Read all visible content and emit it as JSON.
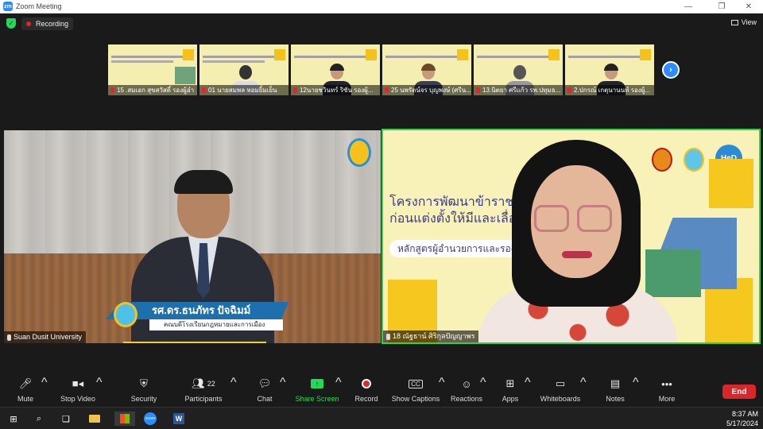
{
  "window": {
    "logo": "zm",
    "title": "Zoom Meeting",
    "controls": [
      "minimize-icon",
      "restore-icon",
      "close-icon"
    ]
  },
  "topbar": {
    "recording_label": "Recording",
    "view_label": "View"
  },
  "thumbnails": [
    {
      "name": "15 .สมเอก สุขสวัสดิ์ รองผู้อำ"
    },
    {
      "name": "01 นายสมพล หอมยิ้มเย็น"
    },
    {
      "name": "12นายชวินทร์ ริซัน รองผู้..."
    },
    {
      "name": "25 นพรัตน์จร บุญพงษ์ (ศรีน..."
    },
    {
      "name": "13.นิตยา ศรีแก้ว รพ.ปทุมธ..."
    },
    {
      "name": "2.ปกรณ์ เกตุนานนท์ รองผู้..."
    }
  ],
  "left_tile": {
    "lower_third_name": "รศ.ดร.ธนภัทร ปัจฉิมม์",
    "lower_third_title": "คณบดีโรงเรียนกฎหมายและการเมือง",
    "participant_name": "Suan Dusit University"
  },
  "right_tile": {
    "slide_title_line1": "โครงการพัฒนาข้าราชการ         ารศึกษา",
    "slide_title_line2": "ก่อนแต่งตั้งให้มีและเลื่อน",
    "slide_subtitle": "หลักสูตรผู้อำนวยการและรอง                        ะที่ 142",
    "hed_logo": "HeD",
    "participant_name": "18 ณัฐธาน์ ศิริกุลปัญญาพร"
  },
  "toolbar": {
    "items": [
      {
        "label": "Mute",
        "icon": "microphone-icon"
      },
      {
        "label": "Stop Video",
        "icon": "video-camera-icon"
      },
      {
        "label": "Security",
        "icon": "shield-icon"
      },
      {
        "label": "Participants",
        "icon": "participants-icon",
        "badge": "22"
      },
      {
        "label": "Chat",
        "icon": "chat-icon"
      },
      {
        "label": "Share Screen",
        "icon": "share-screen-icon"
      },
      {
        "label": "Record",
        "icon": "record-icon"
      },
      {
        "label": "Show Captions",
        "icon": "captions-icon",
        "glyph": "CC"
      },
      {
        "label": "Reactions",
        "icon": "reactions-icon"
      },
      {
        "label": "Apps",
        "icon": "apps-icon"
      },
      {
        "label": "Whiteboards",
        "icon": "whiteboard-icon"
      },
      {
        "label": "Notes",
        "icon": "notes-icon"
      },
      {
        "label": "More",
        "icon": "more-icon"
      }
    ],
    "end_label": "End",
    "share_color": "#23d959",
    "end_color": "#d8262a"
  },
  "taskbar": {
    "time": "8:37 AM",
    "date": "5/17/2024",
    "zoom_label": "zoom",
    "word_label": "W"
  }
}
